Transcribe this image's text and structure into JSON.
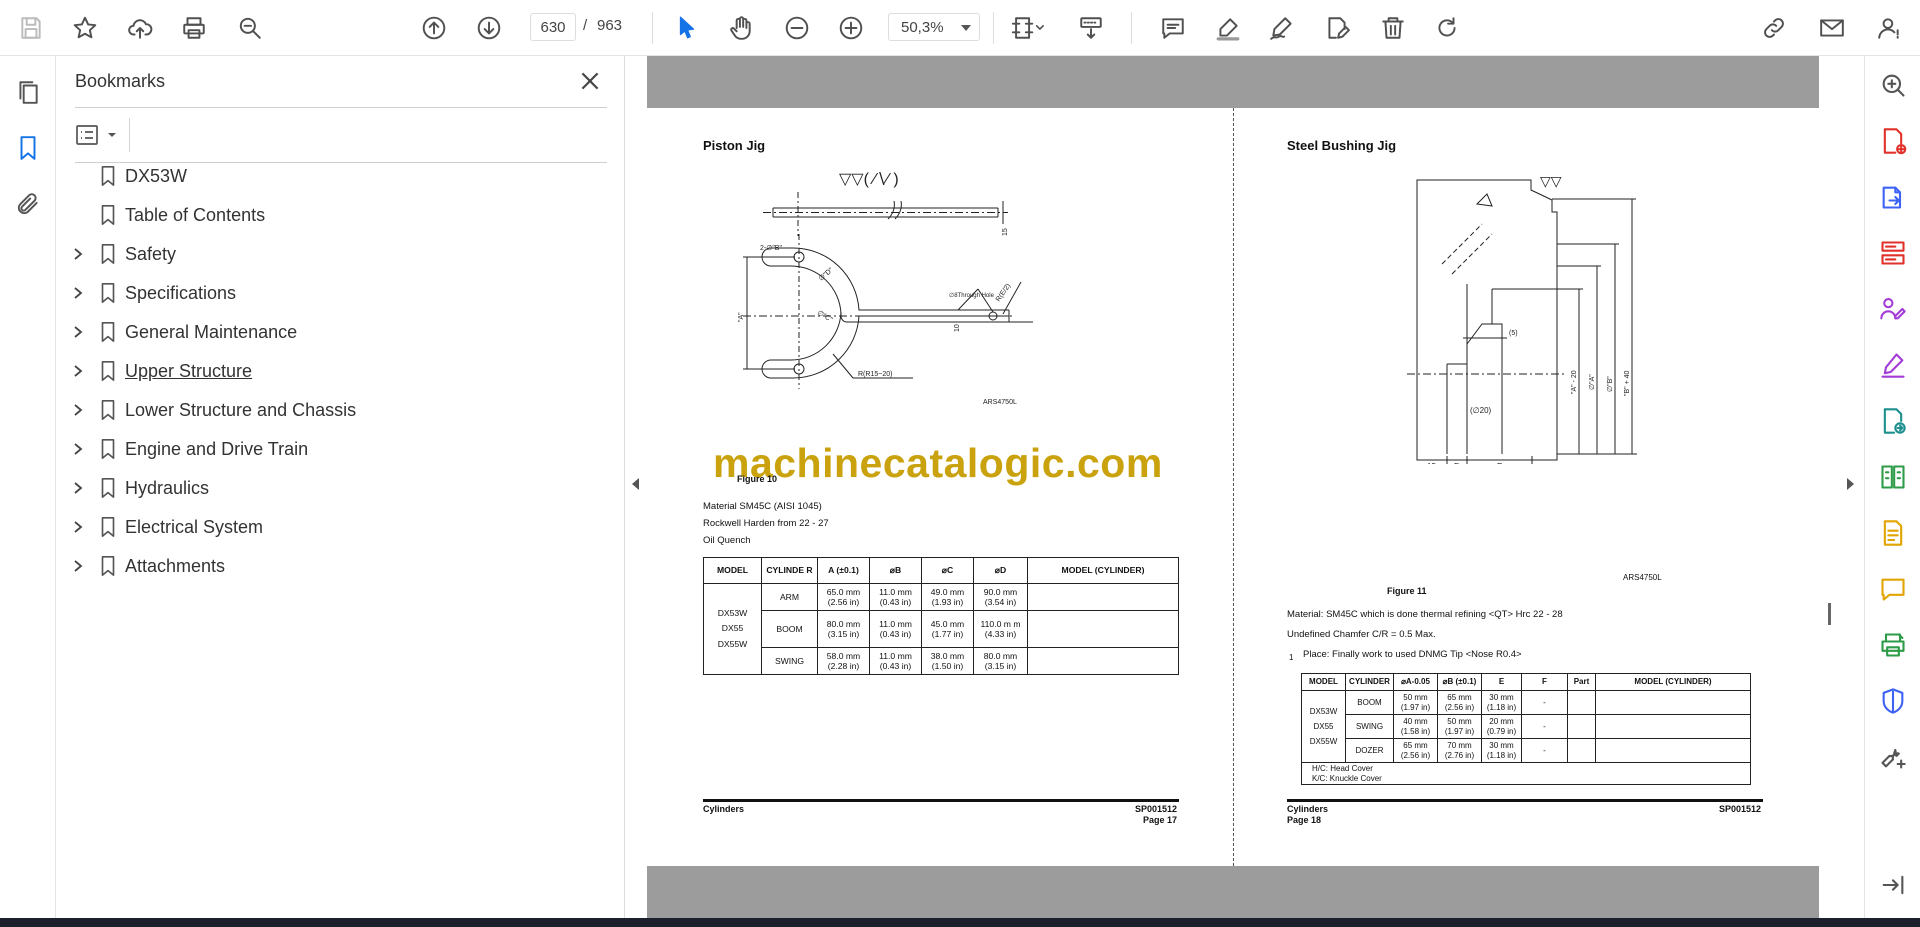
{
  "toolbar": {
    "current_page": "630",
    "page_separator": "/",
    "total_pages": "963",
    "zoom": "50,3%"
  },
  "bookmarks_panel": {
    "title": "Bookmarks",
    "items": [
      {
        "label": "DX53W",
        "expandable": false
      },
      {
        "label": "Table of Contents",
        "expandable": false
      },
      {
        "label": "Safety",
        "expandable": true
      },
      {
        "label": "Specifications",
        "expandable": true
      },
      {
        "label": "General Maintenance",
        "expandable": true
      },
      {
        "label": "Upper Structure",
        "expandable": true
      },
      {
        "label": "Lower Structure and Chassis",
        "expandable": true
      },
      {
        "label": "Engine and Drive Train",
        "expandable": true
      },
      {
        "label": "Hydraulics",
        "expandable": true
      },
      {
        "label": "Electrical System",
        "expandable": true
      },
      {
        "label": "Attachments",
        "expandable": true
      }
    ]
  },
  "document": {
    "watermark": "machinecatalogic.com",
    "left_page": {
      "title": "Piston Jig",
      "symbol": "▽▽( ∕∖∕ )",
      "figure_caption": "Figure 10",
      "figure_code": "ARS4750L",
      "callouts": {
        "holes": "2-∅\"B\"",
        "dim_d": "∅\"D\"",
        "dim_c": "∅\"C\"",
        "dim_a": "\"A\"",
        "through_hole": "∅8Through Hole",
        "radius_end": "R(E/2)",
        "radius_mid": "R(R15~20)",
        "dim_15": "15",
        "dim_10": "10"
      },
      "notes": [
        "Material SM45C (AISI 1045)",
        "Rockwell Harden from 22 - 27",
        "Oil Quench"
      ],
      "table": {
        "headers": [
          "MODEL",
          "CYLINDE R",
          "A (±0.1)",
          "⌀B",
          "⌀C",
          "⌀D",
          "MODEL (CYLINDER)"
        ],
        "models": [
          "DX53W",
          "DX55",
          "DX55W"
        ],
        "rows": [
          {
            "cylinder": "ARM",
            "a": "65.0 mm (2.56 in)",
            "b": "11.0 mm (0.43 in)",
            "c": "49.0 mm (1.93 in)",
            "d": "90.0 mm (3.54 in)"
          },
          {
            "cylinder": "BOOM",
            "a": "80.0 mm (3.15 in)",
            "b": "11.0 mm (0.43 in)",
            "c": "45.0 mm (1.77 in)",
            "d": "110.0 m m (4.33 in)"
          },
          {
            "cylinder": "SWING",
            "a": "58.0 mm (2.28 in)",
            "b": "11.0 mm (0.43 in)",
            "c": "38.0 mm (1.50 in)",
            "d": "80.0 mm (3.15 in)"
          }
        ]
      },
      "footer_left": "Cylinders",
      "footer_right": "SP001512",
      "page_label": "Page 17"
    },
    "right_page": {
      "title": "Steel Bushing Jig",
      "symbol": "▽▽",
      "figure_caption": "Figure 11",
      "figure_code": "ARS4750L",
      "callouts": {
        "dim_5": "(5)",
        "dia_20": "(∅20)",
        "dim_a20": "\"A\" - 20",
        "dia_a": "∅\"A\"",
        "dia_b": "∅\"B\"",
        "dim_b40": "\"B\" + 40",
        "dim_15": "15",
        "dim_f": "F",
        "dim_e": "E"
      },
      "notes": [
        "Material: SM45C which is done thermal refining <QT> Hrc 22 - 28",
        "Undefined Chamfer C/R = 0.5 Max."
      ],
      "numbered_note_num": "1",
      "numbered_note": "Place: Finally work to used DNMG Tip <Nose R0.4>",
      "table": {
        "headers": [
          "MODEL",
          "CYLINDER",
          "⌀A-0.05",
          "⌀B (±0.1)",
          "E",
          "F",
          "Part",
          "MODEL (CYLINDER)"
        ],
        "models": [
          "DX53W",
          "DX55",
          "DX55W"
        ],
        "rows": [
          {
            "cylinder": "BOOM",
            "a": "50 mm (1.97 in)",
            "b": "65 mm (2.56 in)",
            "e": "30 mm (1.18 in)",
            "f": "-"
          },
          {
            "cylinder": "SWING",
            "a": "40 mm (1.58 in)",
            "b": "50 mm (1.97 in)",
            "e": "20 mm (0.79 in)",
            "f": "-"
          },
          {
            "cylinder": "DOZER",
            "a": "65 mm (2.56 in)",
            "b": "70 mm (2.76 in)",
            "e": "30 mm (1.18 in)",
            "f": "-"
          }
        ],
        "legend": [
          "H/C: Head Cover",
          "K/C: Knuckle Cover"
        ]
      },
      "footer_left": "Cylinders",
      "footer_right": "SP001512",
      "page_label": "Page 18"
    }
  }
}
